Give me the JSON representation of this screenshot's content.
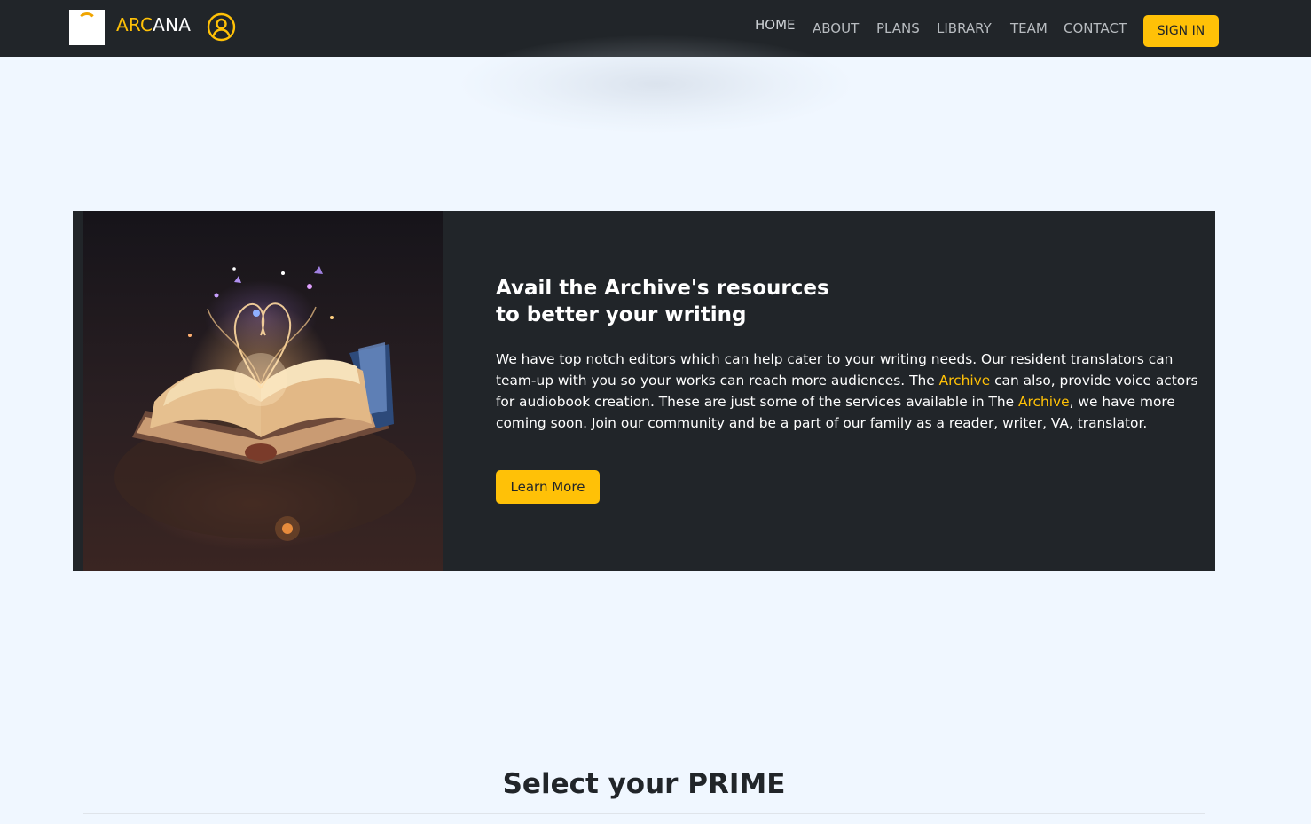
{
  "nav": {
    "brand_part1": "ARC",
    "brand_part2": "ANA",
    "logo_icon": "arc-logo-icon",
    "user_icon": "user-circle-icon",
    "links": [
      "HOME",
      "ABOUT",
      "PLANS",
      "LIBRARY",
      "TEAM",
      "CONTACT"
    ],
    "signin_label": "SIGN IN"
  },
  "feature": {
    "image_icon": "magic-book-illustration",
    "title_line1": "Avail the Archive's resources",
    "title_line2": "to better your writing",
    "body_part1": "We have top notch editors which can help cater to your writing needs. Our resident translators can team-up with you so your works can reach more audiences. The ",
    "body_link1": "Archive",
    "body_part2": " can also, provide voice actors for audiobook creation. These are just some of the services available in The ",
    "body_link2": "Archive",
    "body_part3": ", we have more coming soon. Join our community and be a part of our family as a reader, writer, VA, translator.",
    "button_label": "Learn More"
  },
  "prime": {
    "title": "Select your PRIME"
  },
  "colors": {
    "accent": "#ffc107",
    "dark": "#212529",
    "page_bg": "#f0f7ff"
  }
}
